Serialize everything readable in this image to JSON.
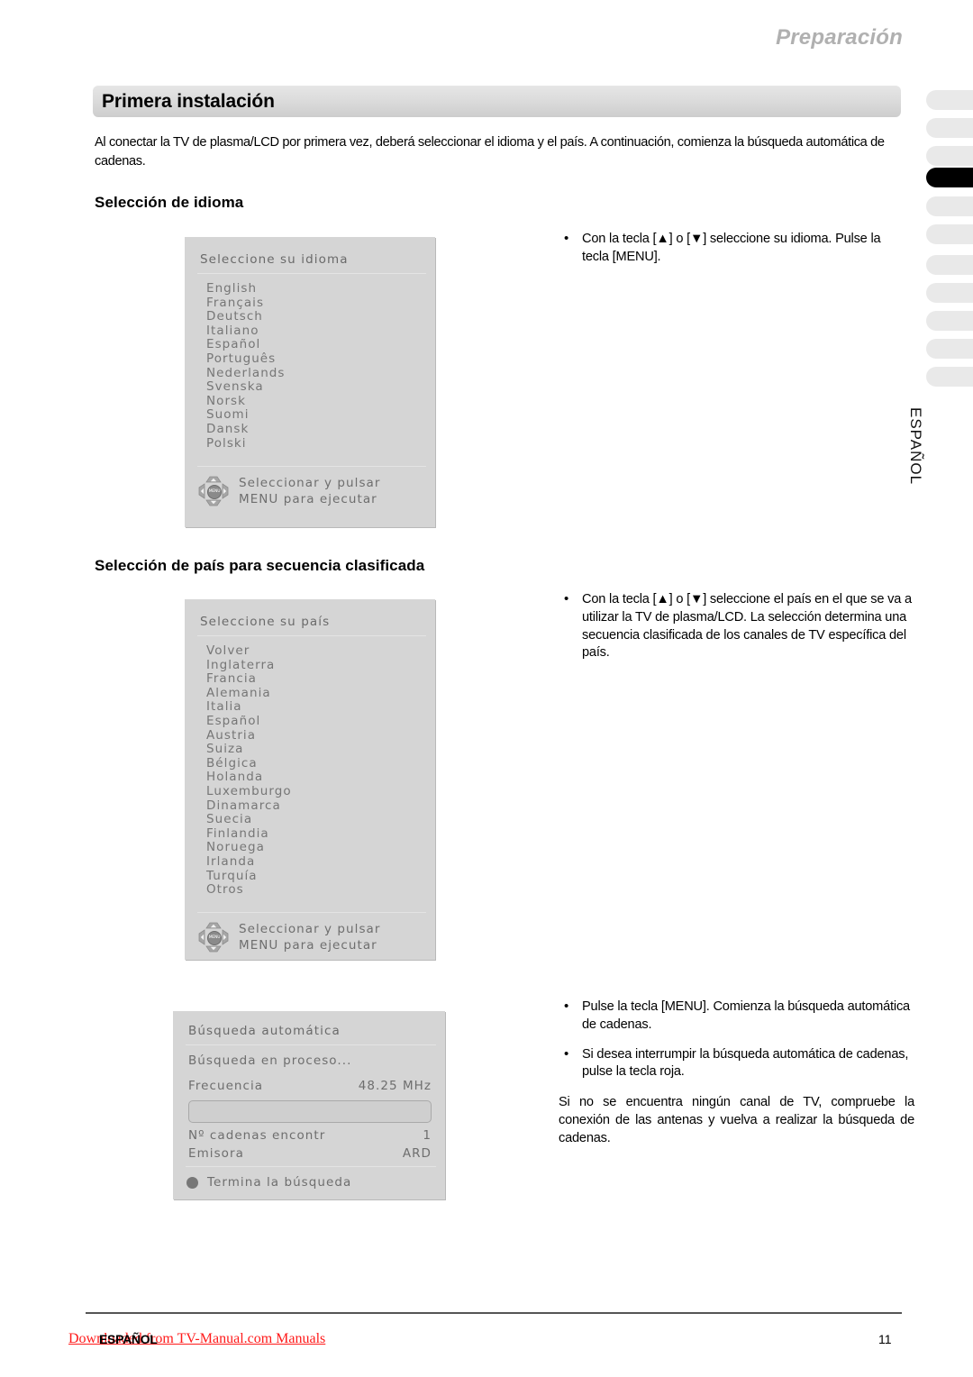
{
  "header": {
    "section": "Preparación"
  },
  "title_bar": {
    "title": "Primera instalación"
  },
  "intro": {
    "text": "Al conectar la TV de plasma/LCD por primera vez, deberá seleccionar el idioma y el país. A continuación, comienza la búsqueda automática de cadenas."
  },
  "sections": {
    "language_heading": "Selección de idioma",
    "country_heading": "Selección de país para secuencia clasificada"
  },
  "osd_language": {
    "title": "Seleccione su idioma",
    "items": [
      "English",
      "Français",
      "Deutsch",
      "Italiano",
      "Español",
      "Português",
      "Nederlands",
      "Svenska",
      "Norsk",
      "Suomi",
      "Dansk",
      "Polski"
    ],
    "footer_line1": "Seleccionar y pulsar",
    "footer_line2": "MENU para ejecutar",
    "dpad_hub_label": "MENU"
  },
  "osd_country": {
    "title": "Seleccione su país",
    "items": [
      "Volver",
      "Inglaterra",
      "Francia",
      "Alemania",
      "Italia",
      "Español",
      "Austria",
      "Suiza",
      "Bélgica",
      "Holanda",
      "Luxemburgo",
      "Dinamarca",
      "Suecia",
      "Finlandia",
      "Noruega",
      "Irlanda",
      "Turquía",
      "Otros"
    ],
    "footer_line1": "Seleccionar y pulsar",
    "footer_line2": "MENU para ejecutar",
    "dpad_hub_label": "MENU"
  },
  "osd_search": {
    "title": "Búsqueda automática",
    "status": "Búsqueda en proceso...",
    "frequency_label": "Frecuencia",
    "frequency_value": "48.25 MHz",
    "progress_percent": 0,
    "found_label": "Nº cadenas encontr",
    "found_value": "1",
    "station_label": "Emisora",
    "station_value": "ARD",
    "stop_label": "Termina la búsqueda"
  },
  "callouts": {
    "language": [
      "Con la tecla [▲] o [▼] seleccione su idioma. Pulse la tecla [MENU]."
    ],
    "country": [
      "Con la tecla [▲] o [▼] seleccione el país en el que se va a utilizar la TV de plasma/LCD. La selección determina una secuencia clasificada de los canales de TV específica del país."
    ],
    "search_bullet_1": "Pulse la tecla [MENU]. Comienza la búsqueda automática de cadenas.",
    "search_bullet_2": "Si desea interrumpir la búsqueda automática de cadenas, pulse la tecla roja.",
    "search_note": "Si no se encuentra ningún canal de TV, compruebe la conexión de las antenas y vuelva a realizar la búsqueda de cadenas."
  },
  "side_tabs": {
    "count": 11,
    "active_index": 3,
    "label": "ESPAÑOL"
  },
  "footer": {
    "language": "ESPAÑOL",
    "page_number": "11",
    "watermark": "Downloaded from TV-Manual.com Manuals"
  },
  "colors": {
    "osd_background": "#d5d5d5",
    "osd_text": "#6e6e6e",
    "title_bar": "#dcdcdc",
    "header_text": "#b0b0b0",
    "watermark": "#ff1a1a",
    "active_tab": "#000000",
    "inactive_tab": "#e9e9e9"
  }
}
